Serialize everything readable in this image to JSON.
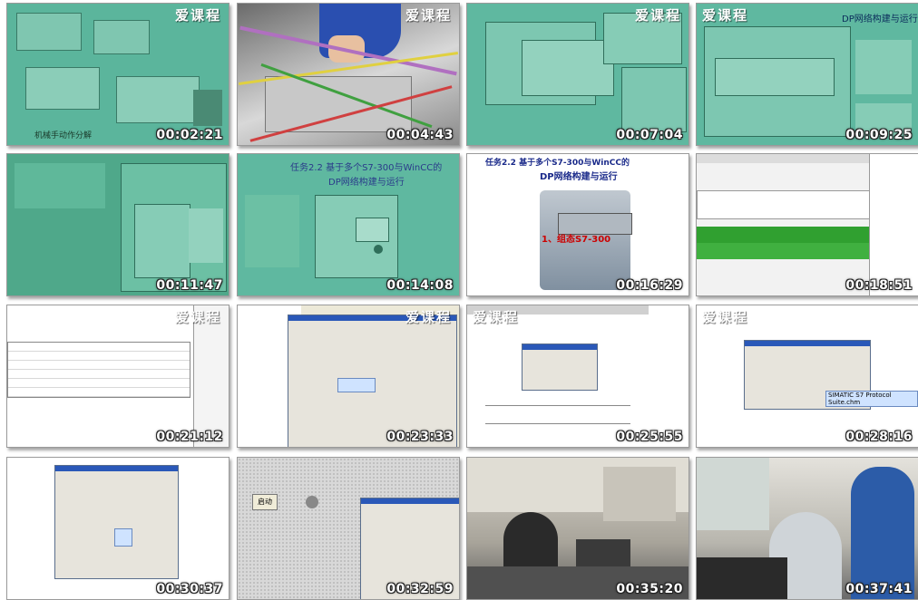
{
  "watermark": "爱课程",
  "thumbnails": [
    {
      "time": "00:02:21",
      "caption": "机械手动作分解"
    },
    {
      "time": "00:04:43"
    },
    {
      "time": "00:07:04"
    },
    {
      "time": "00:09:25",
      "title": "DP网络构建与运行"
    },
    {
      "time": "00:11:47"
    },
    {
      "time": "00:14:08",
      "title": "任务2.2 基于多个S7-300与WinCC的",
      "subtitle": "DP网络构建与运行"
    },
    {
      "time": "00:16:29",
      "title": "任务2.2 基于多个S7-300与WinCC的",
      "subtitle": "DP网络构建与运行",
      "label": "1、组态S7-300"
    },
    {
      "time": "00:18:51"
    },
    {
      "time": "00:21:12"
    },
    {
      "time": "00:23:33"
    },
    {
      "time": "00:25:55"
    },
    {
      "time": "00:28:16",
      "dialog_item": "SIMATIC S7 Protocol Suite.chm"
    },
    {
      "time": "00:30:37"
    },
    {
      "time": "00:32:59",
      "button": "启动"
    },
    {
      "time": "00:35:20"
    },
    {
      "time": "00:37:41"
    }
  ]
}
